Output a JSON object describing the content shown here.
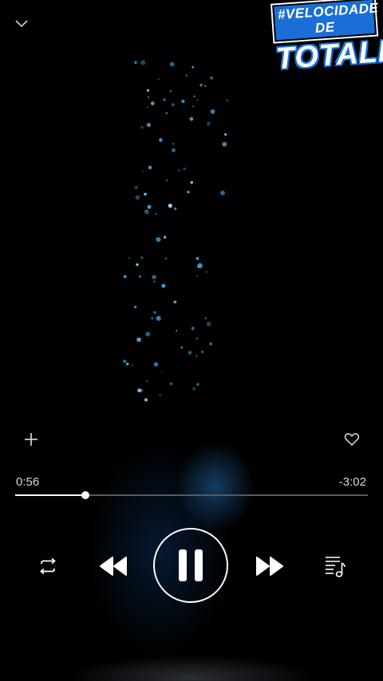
{
  "player": {
    "elapsed": "0:56",
    "remaining": "-3:02",
    "progress": 0.2,
    "state": "playing"
  },
  "watermark": {
    "line1": "#VELOCIDADE DE",
    "line2": "TOTALL"
  },
  "icons": {
    "collapse": "chevron-down-icon",
    "add": "plus-icon",
    "like": "heart-icon",
    "repeat": "repeat-icon",
    "previous": "rewind-icon",
    "pause": "pause-icon",
    "next": "fast-forward-icon",
    "queue": "playlist-icon"
  },
  "colors": {
    "background": "#000000",
    "accent": "#ffffff",
    "sparkle": "#3aa7e8",
    "watermark_blue": "#1a6fd6"
  }
}
